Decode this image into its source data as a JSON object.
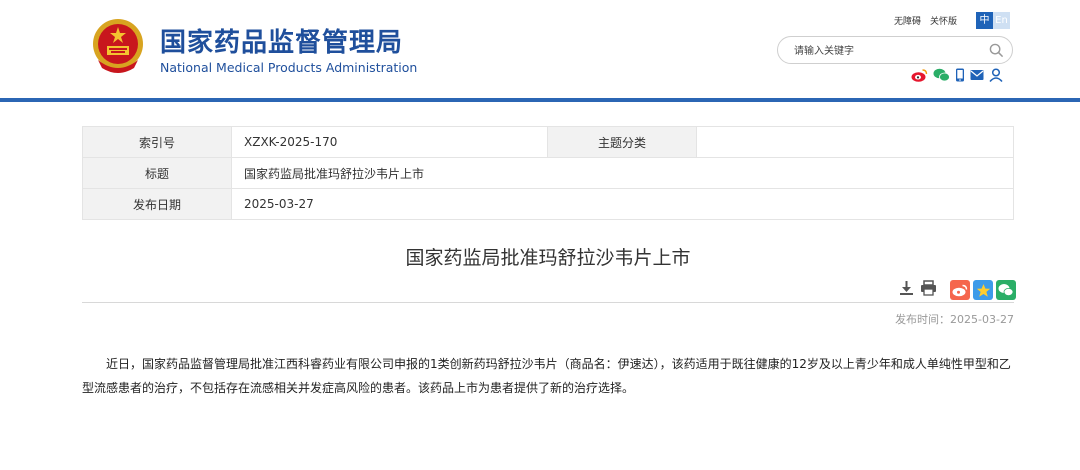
{
  "header": {
    "title_cn": "国家药品监督管理局",
    "title_en": "National Medical Products Administration",
    "links": [
      "无障碍",
      "关怀版"
    ],
    "lang_active": "中",
    "lang_inactive": "En",
    "search_placeholder": "请输入关键字",
    "social_icons": [
      "weibo-icon",
      "wechat-icon",
      "mobile-icon",
      "mail-icon",
      "user-icon"
    ],
    "brand_color": "#1f4f9c",
    "accent_color": "#2b66b4"
  },
  "info": {
    "index_label": "索引号",
    "index_value": "XZXK-2025-170",
    "topic_label": "主题分类",
    "topic_value": "",
    "title_label": "标题",
    "title_value": "国家药监局批准玛舒拉沙韦片上市",
    "date_label": "发布日期",
    "date_value": "2025-03-27"
  },
  "article": {
    "title": "国家药监局批准玛舒拉沙韦片上市",
    "publish_time": "发布时间：2025-03-27",
    "body": "近日，国家药品监督管理局批准江西科睿药业有限公司申报的1类创新药玛舒拉沙韦片（商品名：伊速达），该药适用于既往健康的12岁及以上青少年和成人单纯性甲型和乙型流感患者的治疗，不包括存在流感相关并发症高风险的患者。该药品上市为患者提供了新的治疗选择。",
    "tool_icons": [
      "download-icon",
      "print-icon"
    ],
    "share_icons": [
      "weibo-share-icon",
      "qzone-share-icon",
      "wechat-share-icon"
    ]
  }
}
